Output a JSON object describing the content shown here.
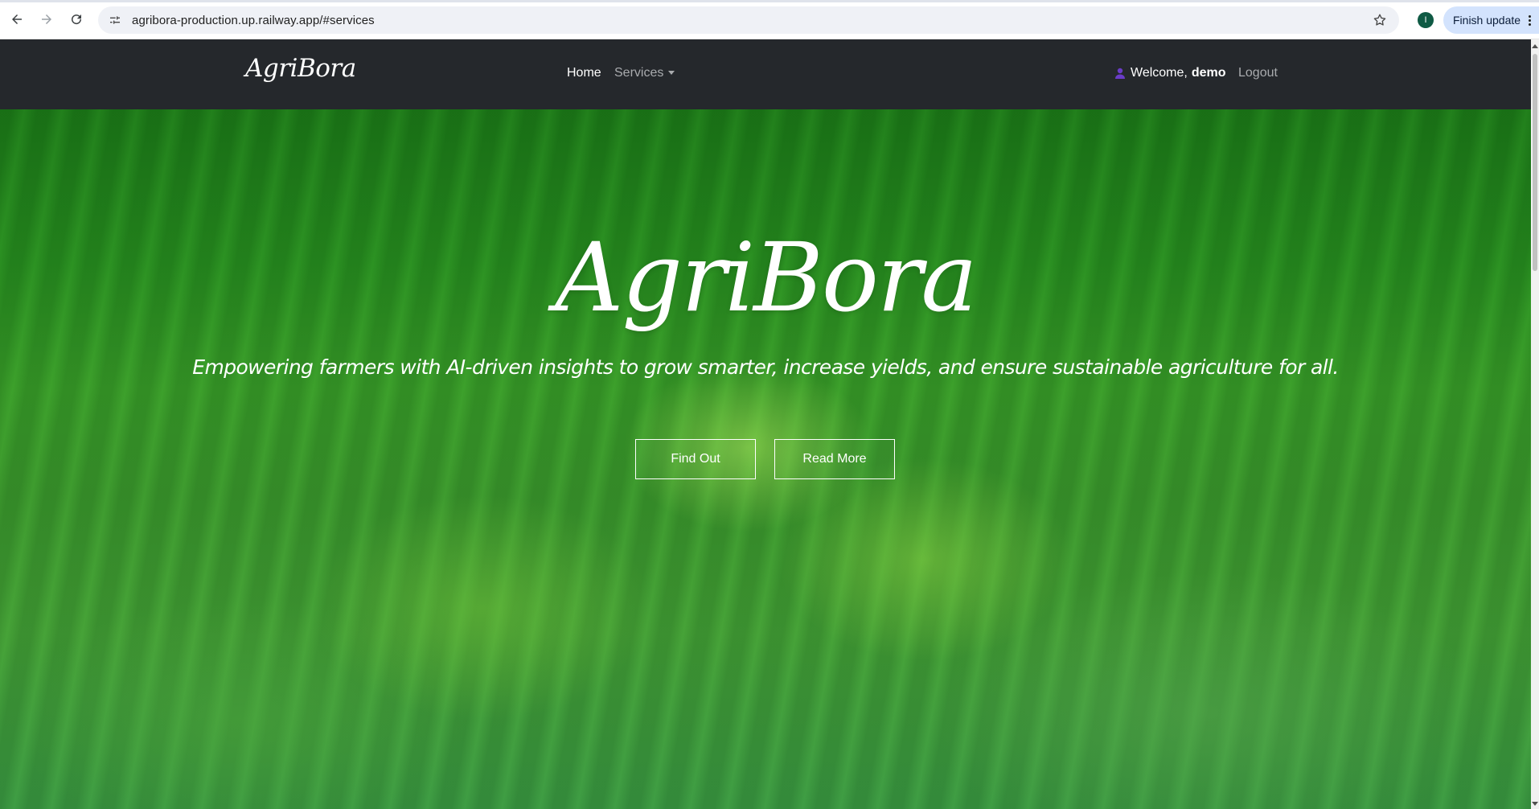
{
  "browser": {
    "url": "agribora-production.up.railway.app/#services",
    "profile_initial": "I",
    "update_label": "Finish update"
  },
  "navbar": {
    "brand": "AgriBora",
    "home_label": "Home",
    "services_label": "Services",
    "welcome_prefix": "Welcome,",
    "username": "demo",
    "logout_label": "Logout"
  },
  "hero": {
    "title": "AgriBora",
    "subtitle": "Empowering farmers with AI-driven insights to grow smarter, increase yields, and ensure sustainable agriculture for all.",
    "find_out_label": "Find Out",
    "read_more_label": "Read More"
  },
  "colors": {
    "navbar_bg": "#25282c",
    "accent_update": "#d3e3fd",
    "avatar_bg": "#0f5a44",
    "user_icon": "#6a3cc8"
  },
  "icons": {
    "back": "back-arrow-icon",
    "forward": "forward-arrow-icon",
    "reload": "reload-icon",
    "site_info": "tune-icon",
    "bookmark": "star-icon",
    "user": "user-icon",
    "menu": "kebab-menu-icon"
  }
}
